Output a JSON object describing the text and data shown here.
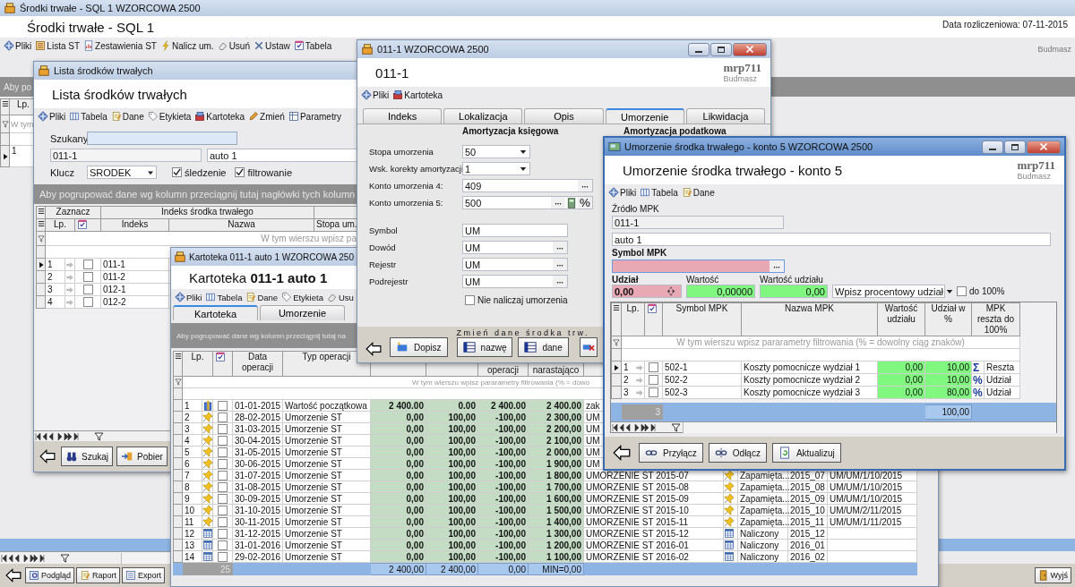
{
  "main_window": {
    "title": "Środki trwałe - SQL 1 WZORCOWA 2500",
    "header": "Środki trwałe - SQL 1",
    "settlement_date": "Data rozliczeniowa: 07-11-2015",
    "company": "Budmasz",
    "toolbar": [
      {
        "label": "Pliki",
        "kind": "diamond"
      },
      {
        "label": "Lista ST",
        "kind": "list"
      },
      {
        "label": "Zestawienia ST",
        "kind": "report"
      },
      {
        "label": "Nalicz um.",
        "kind": "lightning"
      },
      {
        "label": "Usuń",
        "kind": "eraser"
      },
      {
        "label": "Ustaw",
        "kind": "tools"
      },
      {
        "label": "Tabela",
        "kind": "checklist"
      }
    ],
    "group_hint": "Aby po",
    "grid": {
      "header": "Lp.",
      "filter_hint": "W tym",
      "rows": [
        {
          "lp": "1",
          "selected": true
        }
      ]
    },
    "buttons": [
      {
        "label": "Podgląd",
        "kind": "preview"
      },
      {
        "label": "Raport",
        "kind": "document"
      },
      {
        "label": "Export",
        "kind": "sheet"
      },
      {
        "label": "Wyjś",
        "kind": "exit"
      }
    ]
  },
  "asset_list_window": {
    "title": "Lista środków trwałych",
    "header": "Lista środków trwałych",
    "toolbar": [
      {
        "label": "Pliki",
        "kind": "diamond"
      },
      {
        "label": "Tabela",
        "kind": "table"
      },
      {
        "label": "Dane",
        "kind": "document"
      },
      {
        "label": "Etykieta",
        "kind": "tag"
      },
      {
        "label": "Kartoteka",
        "kind": "cardfile"
      },
      {
        "label": "Zmień",
        "kind": "pencil"
      },
      {
        "label": "Parametry",
        "kind": "grid"
      }
    ],
    "search": {
      "label": "Szukany"
    },
    "index_value": "011-1",
    "name_value": "auto 1",
    "key": {
      "label": "Klucz",
      "value": "SRODEK"
    },
    "options": [
      {
        "label": "śledzenie",
        "checked": true
      },
      {
        "label": "filtrowanie",
        "checked": true
      }
    ],
    "group_hint": "Aby pogrupować dane wg kolumn przeciągnij tutaj nagłówki tych kolumn",
    "grid": {
      "bands": [
        "Zaznacz",
        "Indeks środka trwałego"
      ],
      "columns": [
        "Lp.",
        "Indeks",
        "Nazwa",
        "Stopa um."
      ],
      "filter_hint": "W tym wierszu wpisz pa",
      "rows": [
        {
          "lp": "1",
          "index": "011-1",
          "selected": true,
          "checked": false
        },
        {
          "lp": "2",
          "index": "011-2",
          "selected": false,
          "checked": false
        },
        {
          "lp": "3",
          "index": "012-1",
          "selected": false,
          "checked": false
        },
        {
          "lp": "4",
          "index": "012-2",
          "selected": false,
          "checked": false
        }
      ]
    },
    "buttons": [
      {
        "label": "Szukaj",
        "kind": "binoculars"
      },
      {
        "label": "Pobier",
        "kind": "import"
      }
    ]
  },
  "card_window": {
    "title": "Kartoteka 011-1 auto 1 WZORCOWA 250",
    "header": "Kartoteka **011-1 auto 1**",
    "toolbar": [
      {
        "label": "Pliki",
        "kind": "diamond"
      },
      {
        "label": "Tabela",
        "kind": "table"
      },
      {
        "label": "Dane",
        "kind": "document"
      },
      {
        "label": "Etykieta",
        "kind": "tag"
      },
      {
        "label": "Usu",
        "kind": "eraser"
      }
    ],
    "tabs": [
      {
        "label": "Kartoteka",
        "selected": true
      },
      {
        "label": "Umorzenie",
        "selected": false
      }
    ],
    "group_hint": "Aby pogrupować dane wg kolumn przeciągnij tutaj na",
    "headers": {
      "lp": "Lp.",
      "date": "Data operacji",
      "operation": "Typ operacji",
      "column_7": "operacji",
      "column_8": "narastająco"
    },
    "filter_hint": "W tym wierszu wpisz pararametry filtrowania (% = dowo",
    "rows": [
      {
        "lp": "1",
        "kind": "box",
        "checked": false,
        "date": "01-01-2015",
        "operation": "Wartość początkowa",
        "column_5": "2 400.00",
        "column_6": "0.00",
        "column_7": "2 400.00",
        "column_8": "2 400.00",
        "column_9": "zak"
      },
      {
        "lp": "2",
        "kind": "pin",
        "checked": false,
        "date": "28-02-2015",
        "operation": "Umorzenie ST",
        "column_5": "0,00",
        "column_6": "100,00",
        "column_7": "-100,00",
        "column_8": "2 300,00",
        "column_9": "UM"
      },
      {
        "lp": "3",
        "kind": "pin",
        "checked": false,
        "date": "31-03-2015",
        "operation": "Umorzenie ST",
        "column_5": "0,00",
        "column_6": "100,00",
        "column_7": "-100,00",
        "column_8": "2 200,00",
        "column_9": "UM"
      },
      {
        "lp": "4",
        "kind": "pin",
        "checked": false,
        "date": "30-04-2015",
        "operation": "Umorzenie ST",
        "column_5": "0,00",
        "column_6": "100,00",
        "column_7": "-100,00",
        "column_8": "2 100,00",
        "column_9": "UM"
      },
      {
        "lp": "5",
        "kind": "pin",
        "checked": false,
        "date": "31-05-2015",
        "operation": "Umorzenie ST",
        "column_5": "0,00",
        "column_6": "100,00",
        "column_7": "-100,00",
        "column_8": "2 000,00",
        "column_9": "UM"
      },
      {
        "lp": "6",
        "kind": "pin",
        "checked": false,
        "date": "30-06-2015",
        "operation": "Umorzenie ST",
        "column_5": "0,00",
        "column_6": "100,00",
        "column_7": "-100,00",
        "column_8": "1 900,00",
        "column_9": "UM"
      },
      {
        "lp": "7",
        "kind": "pin",
        "checked": false,
        "date": "31-07-2015",
        "operation": "Umorzenie ST",
        "column_5": "0,00",
        "column_6": "100,00",
        "column_7": "-100,00",
        "column_8": "1 800,00",
        "column_9": "UMORZENIE ST 2015-07",
        "status": {
          "kind": "pin",
          "label": "Zapamięta..."
        },
        "column_11": "2015_07",
        "column_12": "UM/UM/1/10/2015"
      },
      {
        "lp": "8",
        "kind": "pin",
        "checked": false,
        "date": "31-08-2015",
        "operation": "Umorzenie ST",
        "column_5": "0,00",
        "column_6": "100,00",
        "column_7": "-100,00",
        "column_8": "1 700,00",
        "column_9": "UMORZENIE ST 2015-08",
        "status": {
          "kind": "pin",
          "label": "Zapamięta..."
        },
        "column_11": "2015_08",
        "column_12": "UM/UM/1/10/2015"
      },
      {
        "lp": "9",
        "kind": "pin",
        "checked": false,
        "date": "30-09-2015",
        "operation": "Umorzenie ST",
        "column_5": "0,00",
        "column_6": "100,00",
        "column_7": "-100,00",
        "column_8": "1 600,00",
        "column_9": "UMORZENIE ST 2015-09",
        "status": {
          "kind": "pin",
          "label": "Zapamięta..."
        },
        "column_11": "2015_09",
        "column_12": "UM/UM/1/10/2015"
      },
      {
        "lp": "10",
        "kind": "pin",
        "checked": false,
        "date": "31-10-2015",
        "operation": "Umorzenie ST",
        "column_5": "0,00",
        "column_6": "100,00",
        "column_7": "-100,00",
        "column_8": "1 500,00",
        "column_9": "UMORZENIE ST 2015-10",
        "status": {
          "kind": "pin",
          "label": "Zapamięta..."
        },
        "column_11": "2015_10",
        "column_12": "UM/UM/2/11/2015"
      },
      {
        "lp": "11",
        "kind": "pin",
        "checked": false,
        "date": "30-11-2015",
        "operation": "Umorzenie ST",
        "column_5": "0,00",
        "column_6": "100,00",
        "column_7": "-100,00",
        "column_8": "1 400,00",
        "column_9": "UMORZENIE ST 2015-11",
        "status": {
          "kind": "pin",
          "label": "Zapamięta..."
        },
        "column_11": "2015_11",
        "column_12": "UM/UM/1/11/2015"
      },
      {
        "lp": "12",
        "kind": "calendar",
        "checked": false,
        "date": "31-12-2015",
        "operation": "Umorzenie ST",
        "column_5": "0,00",
        "column_6": "100,00",
        "column_7": "-100,00",
        "column_8": "1 300,00",
        "column_9": "UMORZENIE ST 2015-12",
        "status": {
          "kind": "calendar",
          "label": "Naliczony"
        },
        "column_11": "2015_12"
      },
      {
        "lp": "13",
        "kind": "calendar",
        "checked": false,
        "date": "31-01-2016",
        "operation": "Umorzenie ST",
        "column_5": "0,00",
        "column_6": "100,00",
        "column_7": "-100,00",
        "column_8": "1 200,00",
        "column_9": "UMORZENIE ST 2016-01",
        "status": {
          "kind": "calendar",
          "label": "Naliczony"
        },
        "column_11": "2016_01"
      },
      {
        "lp": "14",
        "kind": "calendar",
        "checked": false,
        "date": "29-02-2016",
        "operation": "Umorzenie ST",
        "column_5": "0,00",
        "column_6": "100,00",
        "column_7": "-100,00",
        "column_8": "1 100,00",
        "column_9": "UMORZENIE ST 2016-02",
        "status": {
          "kind": "calendar",
          "label": "Naliczony"
        },
        "column_11": "2016_02"
      }
    ],
    "footer": {
      "count": "25",
      "totals": [
        "2 400,00",
        "2 400,00",
        "0,00",
        "MIN=0,00"
      ]
    }
  },
  "asset_window": {
    "title": "011-1 WZORCOWA 2500",
    "header": "011-1",
    "logo": "mrp711",
    "company": "Budmasz",
    "toolbar": [
      {
        "label": "Pliki",
        "kind": "diamond"
      },
      {
        "label": "Kartoteka",
        "kind": "cardfile"
      }
    ],
    "tabs": [
      {
        "label": "Indeks",
        "selected": false
      },
      {
        "label": "Lokalizacja",
        "selected": false
      },
      {
        "label": "Opis",
        "selected": false
      },
      {
        "label": "Umorzenie",
        "selected": true
      },
      {
        "label": "Likwidacja",
        "selected": false
      }
    ],
    "sections": [
      "Amortyzacja księgowa",
      "Amortyzacja podatkowa"
    ],
    "fields": [
      {
        "label": "Stopa umorzenia",
        "value": "50",
        "kind": "select"
      },
      {
        "label": "Wsk. korekty amortyzacji",
        "value": "1",
        "kind": "select"
      },
      {
        "label": "Konto umorzenia 4:",
        "value": "409",
        "kind": "lookup"
      },
      {
        "label": "Konto umorzenia 5:",
        "value": "500",
        "kind": "lookup_extra",
        "suffix": "%"
      },
      {
        "label": "Symbol",
        "value": "UM",
        "kind": "text"
      },
      {
        "label": "Dowód",
        "value": "UM",
        "kind": "short_lookup"
      },
      {
        "label": "Rejestr",
        "value": "UM",
        "kind": "short_lookup"
      },
      {
        "label": "Podrejestr",
        "value": "UM",
        "kind": "short_lookup"
      }
    ],
    "no_depreciation": {
      "label": "Nie naliczaj umorzenia",
      "checked": false
    },
    "add_button": {
      "label": "Dopisz"
    },
    "change_caption": "Zmień dane środka trw.",
    "change_buttons": [
      {
        "label": "nazwę"
      },
      {
        "label": "dane"
      }
    ]
  },
  "depreciation_window": {
    "title": "Umorzenie środka trwałego - konto 5 WZORCOWA 2500",
    "header": "Umorzenie środka trwałego - konto 5",
    "logo": "mrp711",
    "company": "Budmasz",
    "toolbar": [
      {
        "label": "Pliki",
        "kind": "diamond"
      },
      {
        "label": "Tabela",
        "kind": "table"
      },
      {
        "label": "Dane",
        "kind": "document"
      }
    ],
    "source": {
      "label": "Źródło MPK",
      "code": "011-1",
      "name": "auto 1"
    },
    "symbol": {
      "label": "Symbol MPK"
    },
    "share": {
      "label": "Udział",
      "value": "0,00"
    },
    "amount": {
      "label": "Wartość",
      "value": "0,00000"
    },
    "share_amount": {
      "label": "Wartość udziału",
      "value": "0,00"
    },
    "mode": {
      "value": "Wpisz procentowy udział"
    },
    "to_100": {
      "label": "do 100%",
      "checked": false
    },
    "grid": {
      "columns": [
        "Lp.",
        "Symbol MPK",
        "Nazwa MPK",
        "Wartość udziału",
        "Udział w %",
        "MPK reszta do 100%"
      ],
      "filter_hint": "W tym wierszu wpisz pararametry filtrowania (% = dowolny ciąg znaków)",
      "rows": [
        {
          "lp": "1",
          "selected": true,
          "checked": false,
          "symbol": "502-1",
          "name": "Koszty pomocnicze wydział 1",
          "amount": "0,00",
          "percent": "10,00",
          "mark": "Σ",
          "mode": "Reszta"
        },
        {
          "lp": "2",
          "selected": false,
          "checked": false,
          "symbol": "502-2",
          "name": "Koszty pomocnicze wydział 2",
          "amount": "0,00",
          "percent": "10,00",
          "mark": "%",
          "mode": "Udział"
        },
        {
          "lp": "3",
          "selected": false,
          "checked": false,
          "symbol": "502-3",
          "name": "Koszty pomocnicze wydział 3",
          "amount": "0,00",
          "percent": "80,00",
          "mark": "%",
          "mode": "Udział"
        }
      ],
      "footer": {
        "count": "3",
        "total": "100,00"
      }
    },
    "buttons": [
      {
        "label": "Przyłącz",
        "kind": "link"
      },
      {
        "label": "Odłącz",
        "kind": "unlink"
      },
      {
        "label": "Aktualizuj",
        "kind": "refresh"
      }
    ]
  }
}
